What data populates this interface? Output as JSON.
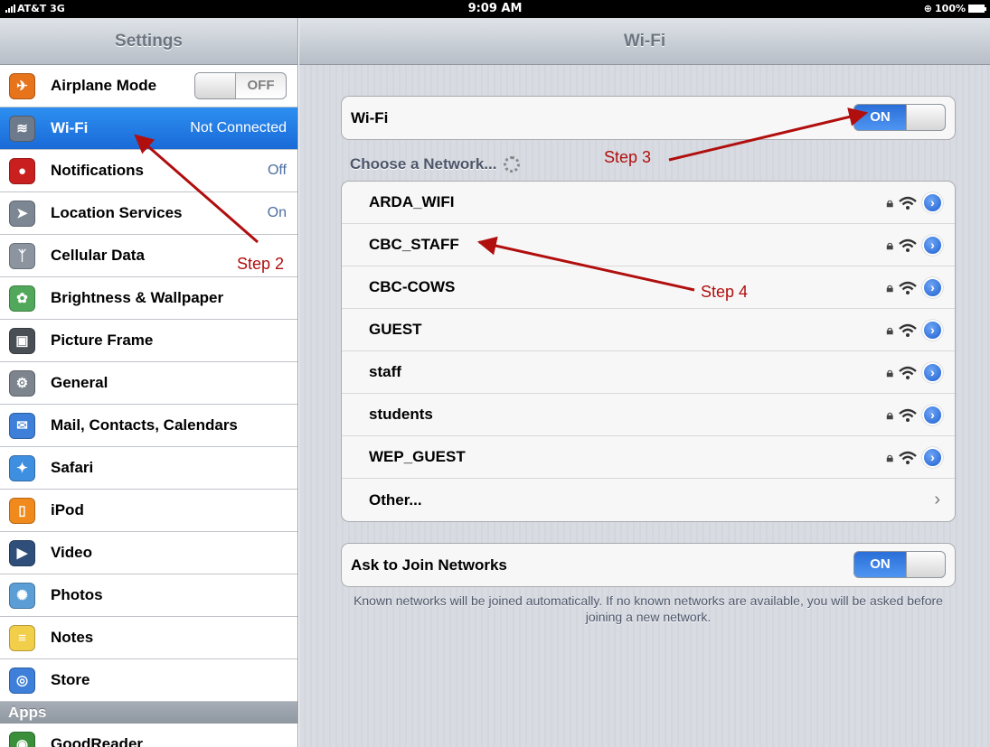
{
  "status_bar": {
    "carrier": "AT&T 3G",
    "time": "9:09 AM",
    "battery": "100%"
  },
  "sidebar": {
    "title": "Settings",
    "items": [
      {
        "label": "Airplane Mode",
        "value": "",
        "toggle": "OFF",
        "icon": "airplane-icon",
        "color": "#e7731b"
      },
      {
        "label": "Wi-Fi",
        "value": "Not Connected",
        "icon": "wifi-icon",
        "color": "#6c7a8c"
      },
      {
        "label": "Notifications",
        "value": "Off",
        "icon": "notifications-icon",
        "color": "#c9201f"
      },
      {
        "label": "Location Services",
        "value": "On",
        "icon": "location-arrow-icon",
        "color": "#7d8794"
      },
      {
        "label": "Cellular Data",
        "value": "",
        "icon": "antenna-icon",
        "color": "#8c94a0"
      },
      {
        "label": "Brightness & Wallpaper",
        "value": "",
        "icon": "flower-icon",
        "color": "#52a85a"
      },
      {
        "label": "Picture Frame",
        "value": "",
        "icon": "picture-frame-icon",
        "color": "#4a4f56"
      },
      {
        "label": "General",
        "value": "",
        "icon": "gear-icon",
        "color": "#7d848d"
      },
      {
        "label": "Mail, Contacts, Calendars",
        "value": "",
        "icon": "mail-icon",
        "color": "#3d7fd9"
      },
      {
        "label": "Safari",
        "value": "",
        "icon": "compass-icon",
        "color": "#3f8fe0"
      },
      {
        "label": "iPod",
        "value": "",
        "icon": "ipod-icon",
        "color": "#f08a1c"
      },
      {
        "label": "Video",
        "value": "",
        "icon": "clapperboard-icon",
        "color": "#2f4f7a"
      },
      {
        "label": "Photos",
        "value": "",
        "icon": "sunflower-icon",
        "color": "#5b9ed6"
      },
      {
        "label": "Notes",
        "value": "",
        "icon": "notepad-icon",
        "color": "#f2cf4b"
      },
      {
        "label": "Store",
        "value": "",
        "icon": "store-icon",
        "color": "#3d7fd9"
      }
    ],
    "apps_header": "Apps",
    "apps_partial": "GoodReader"
  },
  "main": {
    "title": "Wi-Fi",
    "wifi_row": {
      "label": "Wi-Fi",
      "toggle": "ON"
    },
    "choose_label": "Choose a Network...",
    "networks": [
      {
        "name": "ARDA_WIFI"
      },
      {
        "name": "CBC_STAFF"
      },
      {
        "name": "CBC-COWS"
      },
      {
        "name": "GUEST"
      },
      {
        "name": "staff"
      },
      {
        "name": "students"
      },
      {
        "name": "WEP_GUEST"
      }
    ],
    "other_label": "Other...",
    "ask_row": {
      "label": "Ask to Join Networks",
      "toggle": "ON"
    },
    "footnote": "Known networks will be joined automatically.  If no known networks are available, you will be asked before joining a new network."
  },
  "annotations": {
    "step2": "Step 2",
    "step3": "Step 3",
    "step4": "Step 4",
    "color": "#b10e0e"
  }
}
